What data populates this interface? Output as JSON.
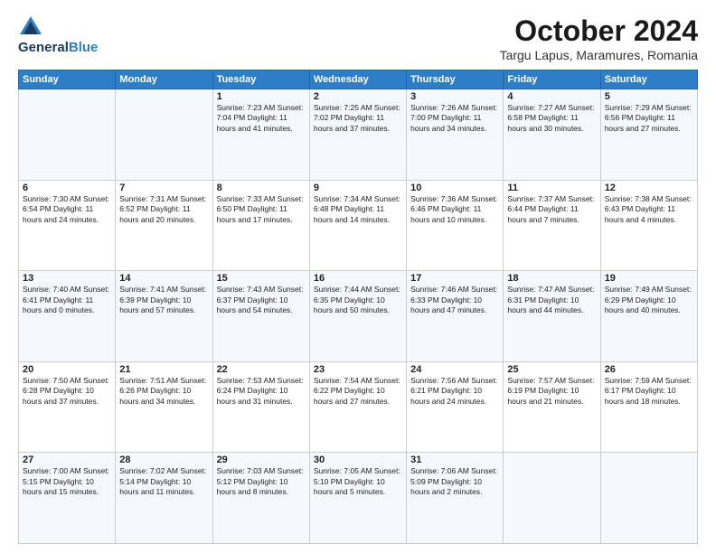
{
  "header": {
    "logo_line1": "General",
    "logo_line2": "Blue",
    "month": "October 2024",
    "location": "Targu Lapus, Maramures, Romania"
  },
  "days_of_week": [
    "Sunday",
    "Monday",
    "Tuesday",
    "Wednesday",
    "Thursday",
    "Friday",
    "Saturday"
  ],
  "weeks": [
    [
      {
        "day": "",
        "info": ""
      },
      {
        "day": "",
        "info": ""
      },
      {
        "day": "1",
        "info": "Sunrise: 7:23 AM\nSunset: 7:04 PM\nDaylight: 11 hours and 41 minutes."
      },
      {
        "day": "2",
        "info": "Sunrise: 7:25 AM\nSunset: 7:02 PM\nDaylight: 11 hours and 37 minutes."
      },
      {
        "day": "3",
        "info": "Sunrise: 7:26 AM\nSunset: 7:00 PM\nDaylight: 11 hours and 34 minutes."
      },
      {
        "day": "4",
        "info": "Sunrise: 7:27 AM\nSunset: 6:58 PM\nDaylight: 11 hours and 30 minutes."
      },
      {
        "day": "5",
        "info": "Sunrise: 7:29 AM\nSunset: 6:56 PM\nDaylight: 11 hours and 27 minutes."
      }
    ],
    [
      {
        "day": "6",
        "info": "Sunrise: 7:30 AM\nSunset: 6:54 PM\nDaylight: 11 hours and 24 minutes."
      },
      {
        "day": "7",
        "info": "Sunrise: 7:31 AM\nSunset: 6:52 PM\nDaylight: 11 hours and 20 minutes."
      },
      {
        "day": "8",
        "info": "Sunrise: 7:33 AM\nSunset: 6:50 PM\nDaylight: 11 hours and 17 minutes."
      },
      {
        "day": "9",
        "info": "Sunrise: 7:34 AM\nSunset: 6:48 PM\nDaylight: 11 hours and 14 minutes."
      },
      {
        "day": "10",
        "info": "Sunrise: 7:36 AM\nSunset: 6:46 PM\nDaylight: 11 hours and 10 minutes."
      },
      {
        "day": "11",
        "info": "Sunrise: 7:37 AM\nSunset: 6:44 PM\nDaylight: 11 hours and 7 minutes."
      },
      {
        "day": "12",
        "info": "Sunrise: 7:38 AM\nSunset: 6:43 PM\nDaylight: 11 hours and 4 minutes."
      }
    ],
    [
      {
        "day": "13",
        "info": "Sunrise: 7:40 AM\nSunset: 6:41 PM\nDaylight: 11 hours and 0 minutes."
      },
      {
        "day": "14",
        "info": "Sunrise: 7:41 AM\nSunset: 6:39 PM\nDaylight: 10 hours and 57 minutes."
      },
      {
        "day": "15",
        "info": "Sunrise: 7:43 AM\nSunset: 6:37 PM\nDaylight: 10 hours and 54 minutes."
      },
      {
        "day": "16",
        "info": "Sunrise: 7:44 AM\nSunset: 6:35 PM\nDaylight: 10 hours and 50 minutes."
      },
      {
        "day": "17",
        "info": "Sunrise: 7:46 AM\nSunset: 6:33 PM\nDaylight: 10 hours and 47 minutes."
      },
      {
        "day": "18",
        "info": "Sunrise: 7:47 AM\nSunset: 6:31 PM\nDaylight: 10 hours and 44 minutes."
      },
      {
        "day": "19",
        "info": "Sunrise: 7:49 AM\nSunset: 6:29 PM\nDaylight: 10 hours and 40 minutes."
      }
    ],
    [
      {
        "day": "20",
        "info": "Sunrise: 7:50 AM\nSunset: 6:28 PM\nDaylight: 10 hours and 37 minutes."
      },
      {
        "day": "21",
        "info": "Sunrise: 7:51 AM\nSunset: 6:26 PM\nDaylight: 10 hours and 34 minutes."
      },
      {
        "day": "22",
        "info": "Sunrise: 7:53 AM\nSunset: 6:24 PM\nDaylight: 10 hours and 31 minutes."
      },
      {
        "day": "23",
        "info": "Sunrise: 7:54 AM\nSunset: 6:22 PM\nDaylight: 10 hours and 27 minutes."
      },
      {
        "day": "24",
        "info": "Sunrise: 7:56 AM\nSunset: 6:21 PM\nDaylight: 10 hours and 24 minutes."
      },
      {
        "day": "25",
        "info": "Sunrise: 7:57 AM\nSunset: 6:19 PM\nDaylight: 10 hours and 21 minutes."
      },
      {
        "day": "26",
        "info": "Sunrise: 7:59 AM\nSunset: 6:17 PM\nDaylight: 10 hours and 18 minutes."
      }
    ],
    [
      {
        "day": "27",
        "info": "Sunrise: 7:00 AM\nSunset: 5:15 PM\nDaylight: 10 hours and 15 minutes."
      },
      {
        "day": "28",
        "info": "Sunrise: 7:02 AM\nSunset: 5:14 PM\nDaylight: 10 hours and 11 minutes."
      },
      {
        "day": "29",
        "info": "Sunrise: 7:03 AM\nSunset: 5:12 PM\nDaylight: 10 hours and 8 minutes."
      },
      {
        "day": "30",
        "info": "Sunrise: 7:05 AM\nSunset: 5:10 PM\nDaylight: 10 hours and 5 minutes."
      },
      {
        "day": "31",
        "info": "Sunrise: 7:06 AM\nSunset: 5:09 PM\nDaylight: 10 hours and 2 minutes."
      },
      {
        "day": "",
        "info": ""
      },
      {
        "day": "",
        "info": ""
      }
    ]
  ]
}
